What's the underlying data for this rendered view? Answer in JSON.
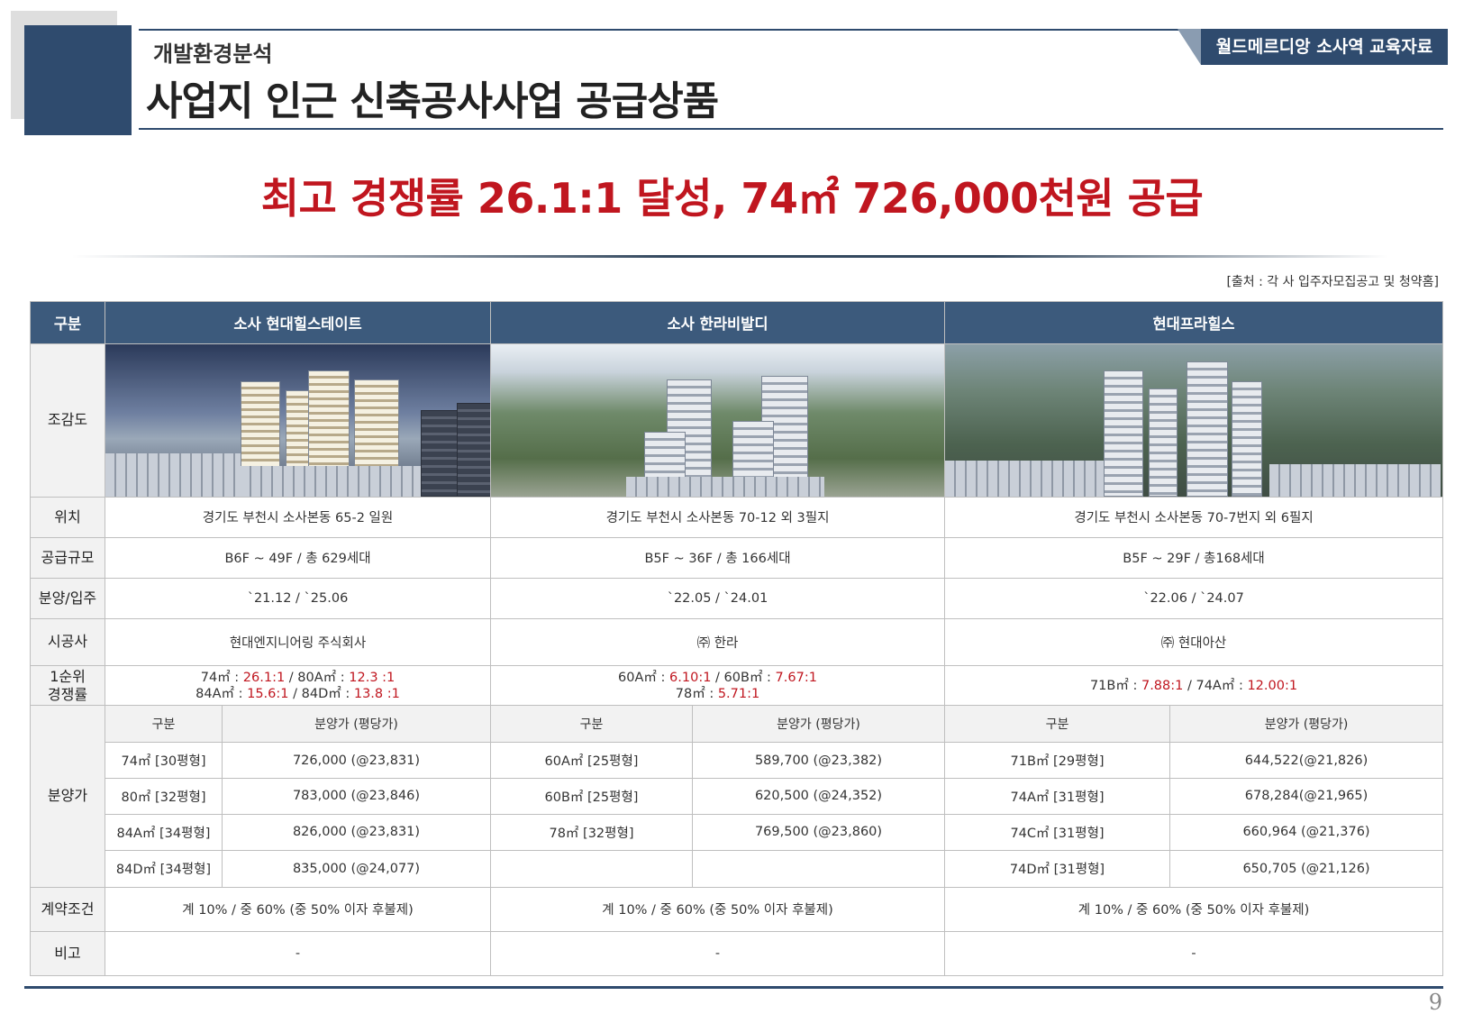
{
  "header": {
    "subtitle": "개발환경분석",
    "title": "사업지 인근 신축공사사업 공급상품",
    "badge": "월드메르디앙 소사역 교육자료"
  },
  "headline": "최고 경쟁률 26.1:1 달성, 74㎡ 726,000천원 공급",
  "source": "[출처 : 각 사 입주자모집공고 및 청약홈]",
  "table": {
    "header_label": "구분",
    "projects": [
      "소사 현대힐스테이트",
      "소사 한라비발디",
      "현대프라힐스"
    ],
    "row_labels": {
      "render": "조감도",
      "location": "위치",
      "scale": "공급규모",
      "schedule": "분양/입주",
      "builder": "시공사",
      "competition": "1순위\n경쟁률",
      "price": "분양가",
      "contract": "계약조건",
      "note": "비고"
    },
    "location": [
      "경기도 부천시 소사본동 65-2 일원",
      "경기도 부천시 소사본동 70-12 외 3필지",
      "경기도 부천시 소사본동 70-7번지 외 6필지"
    ],
    "scale": [
      "B6F ~ 49F / 총 629세대",
      "B5F ~ 36F / 총 166세대",
      "B5F ~ 29F / 총168세대"
    ],
    "schedule": [
      "`21.12 / `25.06",
      "`22.05 / `24.01",
      "`22.06 / `24.07"
    ],
    "builder": [
      "현대엔지니어링 주식회사",
      "㈜ 한라",
      "㈜ 현대아산"
    ],
    "competition": {
      "p1": {
        "line1": [
          {
            "t": "74㎡ : "
          },
          {
            "t": "26.1:1",
            "r": true
          },
          {
            "t": " / 80A㎡ : "
          },
          {
            "t": "12.3 :1",
            "r": true
          }
        ],
        "line2": [
          {
            "t": "84A㎡ : "
          },
          {
            "t": "15.6:1",
            "r": true
          },
          {
            "t": " / 84D㎡ : "
          },
          {
            "t": "13.8 :1",
            "r": true
          }
        ]
      },
      "p2": {
        "line1": [
          {
            "t": "60A㎡ : "
          },
          {
            "t": "6.10:1",
            "r": true
          },
          {
            "t": " / 60B㎡ : "
          },
          {
            "t": "7.67:1",
            "r": true
          }
        ],
        "line2": [
          {
            "t": "78㎡ : "
          },
          {
            "t": "5.71:1",
            "r": true
          }
        ]
      },
      "p3": {
        "line1": [
          {
            "t": "71B㎡ : "
          },
          {
            "t": "7.88:1",
            "r": true
          },
          {
            "t": " / 74A㎡ : "
          },
          {
            "t": "12.00:1",
            "r": true
          }
        ]
      }
    },
    "price_headers": {
      "type": "구분",
      "price": "분양가 (평당가)"
    },
    "prices": [
      [
        [
          "74㎡ [30평형]",
          "726,000 (@23,831)"
        ],
        [
          "60A㎡ [25평형]",
          "589,700 (@23,382)"
        ],
        [
          "71B㎡ [29평형]",
          "644,522(@21,826)"
        ]
      ],
      [
        [
          "80㎡ [32평형]",
          "783,000 (@23,846)"
        ],
        [
          "60B㎡ [25평형]",
          "620,500 (@24,352)"
        ],
        [
          "74A㎡ [31평형]",
          "678,284(@21,965)"
        ]
      ],
      [
        [
          "84A㎡ [34평형]",
          "826,000 (@23,831)"
        ],
        [
          "78㎡ [32평형]",
          "769,500 (@23,860)"
        ],
        [
          "74C㎡ [31평형]",
          "660,964 (@21,376)"
        ]
      ],
      [
        [
          "84D㎡ [34평형]",
          "835,000 (@24,077)"
        ],
        [
          "",
          ""
        ],
        [
          "74D㎡ [31평형]",
          "650,705 (@21,126)"
        ]
      ]
    ],
    "contract": [
      "계 10% / 중 60% (중 50% 이자 후불제)",
      "계 10% / 중 60% (중 50% 이자 후불제)",
      "계 10% / 중 60% (중 50% 이자 후불제)"
    ],
    "note": [
      "-",
      "-",
      "-"
    ]
  },
  "page_number": "9",
  "colors": {
    "navy": "#2f4b6e",
    "header_blue": "#3c5a7c",
    "accent_red": "#c0161f"
  }
}
